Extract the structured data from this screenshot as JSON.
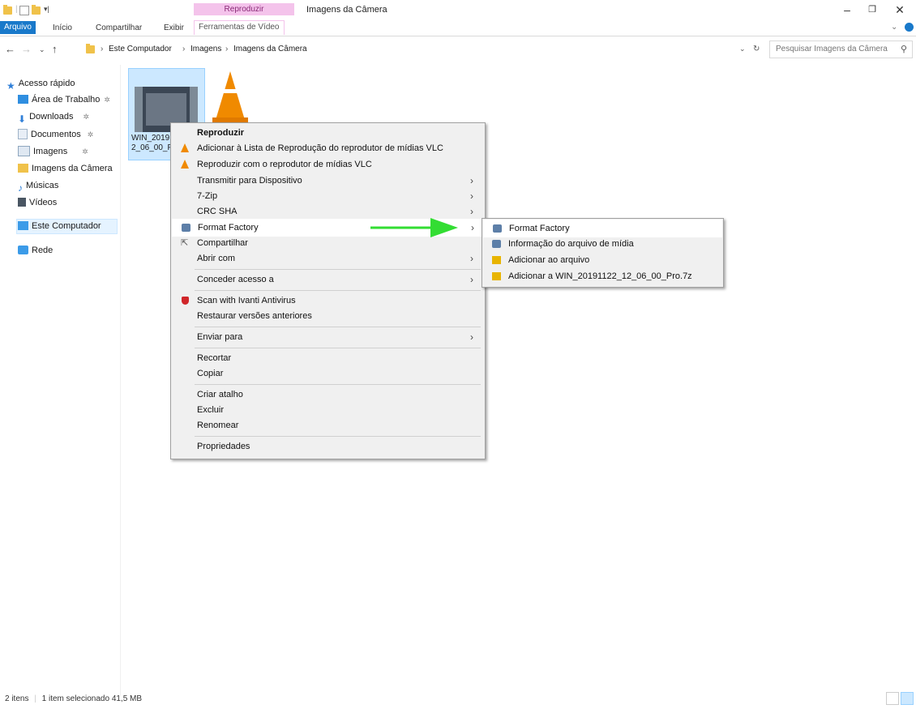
{
  "title_bar": {
    "contextual_tab_head": "Reproduzir",
    "window_title": "Imagens da Câmera",
    "min_glyph": "–",
    "restore_glyph": "❐",
    "close_glyph": "✕"
  },
  "ribbon": {
    "tabs": [
      "Arquivo",
      "Início",
      "Compartilhar",
      "Exibir",
      "Ferramentas de Vídeo"
    ],
    "file_tab_color": "#1979ca",
    "contextual_color": "#f4c3eb"
  },
  "address_bar": {
    "breadcrumb": [
      "Este Computador",
      "Imagens",
      "Imagens da Câmera"
    ],
    "search_placeholder": "Pesquisar Imagens da Câmera"
  },
  "nav_pane": {
    "items": [
      {
        "label": "Acesso rápido",
        "icon": "star-icon",
        "pinned": false
      },
      {
        "label": "Área de Trabalho",
        "icon": "desktop-icon",
        "pinned": true
      },
      {
        "label": "Downloads",
        "icon": "download-icon",
        "pinned": true
      },
      {
        "label": "Documentos",
        "icon": "documents-icon",
        "pinned": true
      },
      {
        "label": "Imagens",
        "icon": "pictures-icon",
        "pinned": true
      },
      {
        "label": "Imagens da Câmera",
        "icon": "folder-icon",
        "pinned": false
      },
      {
        "label": "Músicas",
        "icon": "music-icon",
        "pinned": false
      },
      {
        "label": "Vídeos",
        "icon": "videos-icon",
        "pinned": false
      },
      {
        "label": "Este Computador",
        "icon": "computer-icon",
        "pinned": false
      },
      {
        "label": "Rede",
        "icon": "network-icon",
        "pinned": false
      }
    ],
    "pin_glyph": "✲",
    "selected": "Este Computador"
  },
  "files": [
    {
      "name_line1": "WIN_2019",
      "name_line2": "2_06_00_P",
      "type": "video",
      "selected": true
    },
    {
      "name": "",
      "type": "vlc-file",
      "selected": false
    }
  ],
  "context_menu": {
    "items": [
      {
        "label": "Reproduzir",
        "bold": true
      },
      {
        "label": "Adicionar à Lista de Reprodução do reprodutor de mídias VLC",
        "icon": "vlc-icon"
      },
      {
        "label": "Reproduzir com o reprodutor de mídias VLC",
        "icon": "vlc-icon"
      },
      {
        "label": "Transmitir para Dispositivo",
        "submenu": true
      },
      {
        "label": "7-Zip",
        "submenu": true
      },
      {
        "label": "CRC SHA",
        "submenu": true
      },
      {
        "label": "Format Factory",
        "submenu": true,
        "icon": "format-factory-icon",
        "highlighted": true
      },
      {
        "label": "Compartilhar",
        "icon": "share-icon"
      },
      {
        "label": "Abrir com",
        "submenu": true
      },
      {
        "label": "Conceder acesso a",
        "submenu": true
      },
      {
        "label": "Scan with Ivanti Antivirus",
        "icon": "antivirus-icon"
      },
      {
        "label": "Restaurar versões anteriores"
      },
      {
        "label": "Enviar para",
        "submenu": true
      },
      {
        "label": "Recortar"
      },
      {
        "label": "Copiar"
      },
      {
        "label": "Criar atalho"
      },
      {
        "label": "Excluir"
      },
      {
        "label": "Renomear"
      },
      {
        "label": "Propriedades"
      }
    ],
    "arrow_glyph": "›"
  },
  "submenu": {
    "items": [
      {
        "label": "Format Factory",
        "icon": "format-factory-icon",
        "highlighted": true
      },
      {
        "label": "Informação do arquivo de mídia",
        "icon": "format-factory-icon"
      },
      {
        "label": "Adicionar ao arquivo",
        "icon": "archive-icon"
      },
      {
        "label": "Adicionar a WIN_20191122_12_06_00_Pro.7z",
        "icon": "archive-icon"
      }
    ]
  },
  "annotation": {
    "arrow_color": "#33dd33"
  },
  "status_bar": {
    "item_count": "2 itens",
    "selection": "1 item selecionado",
    "size": "41,5 MB"
  }
}
